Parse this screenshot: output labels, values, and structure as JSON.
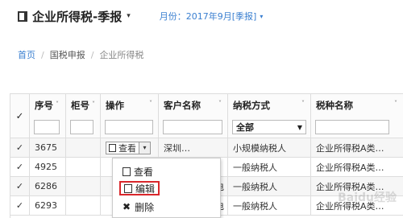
{
  "header": {
    "title": "企业所得税-季报",
    "caret": "▾",
    "period": "月份：2017年9月[季报]",
    "period_caret": "▾"
  },
  "breadcrumb": {
    "home": "首页",
    "sep": "/",
    "level2": "国税申报",
    "current": "企业所得税"
  },
  "table": {
    "columns": {
      "seq": "序号",
      "cabinet": "柜号",
      "op": "操作",
      "customer": "客户名称",
      "taxpayer_type": "纳税方式",
      "tax_type": "税种名称"
    },
    "filter_taxpayer_value": "全部",
    "rows": [
      {
        "seq": "3675",
        "customer": "深圳…",
        "taxpayer_type": "小规模纳税人",
        "tax_type": "企业所得税A类…"
      },
      {
        "seq": "4925",
        "customer": "",
        "taxpayer_type": "一般纳税人",
        "tax_type": "企业所得税A类…"
      },
      {
        "seq": "6286",
        "customer": "亚电",
        "taxpayer_type": "一般纳税人",
        "tax_type": "企业所得税A类…"
      },
      {
        "seq": "6293",
        "customer": "光电",
        "taxpayer_type": "一般纳税人",
        "tax_type": "企业所得税A类…"
      }
    ],
    "view_button": "查看",
    "check": "✓",
    "sort_glyph": "˅"
  },
  "dropdown": {
    "view": "查看",
    "edit": "编辑",
    "delete": "删除",
    "delete_glyph": "✖"
  },
  "watermark": "Baidu经验"
}
